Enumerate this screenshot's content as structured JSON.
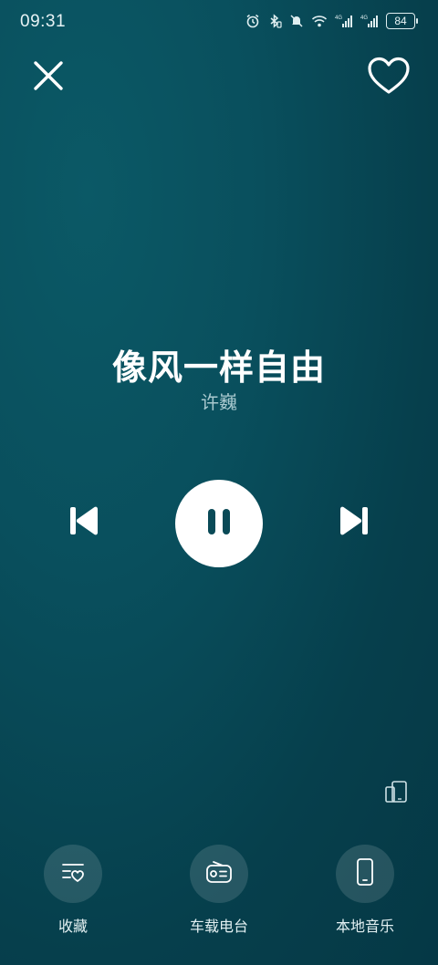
{
  "status_bar": {
    "time": "09:31",
    "battery_level": "84",
    "icons": [
      "alarm-icon",
      "bluetooth-icon",
      "mute-icon",
      "wifi-icon",
      "signal-4g-icon",
      "signal-4g-icon"
    ]
  },
  "header": {
    "close_icon": "close-icon",
    "favorite_icon": "heart-icon"
  },
  "song": {
    "title": "像风一样自由",
    "artist": "许巍"
  },
  "controls": {
    "previous_icon": "skip-previous-icon",
    "play_pause_icon": "pause-icon",
    "next_icon": "skip-next-icon",
    "device_switch_icon": "switch-device-icon"
  },
  "bottom_nav": [
    {
      "label": "收藏",
      "icon": "favorites-list-icon"
    },
    {
      "label": "车载电台",
      "icon": "radio-icon"
    },
    {
      "label": "本地音乐",
      "icon": "phone-icon"
    }
  ],
  "colors": {
    "background": "#094f5d",
    "primary_text": "#ffffff",
    "secondary_text": "#a9c9cf",
    "play_button": "#ffffff",
    "play_icon": "#0a4a57"
  }
}
